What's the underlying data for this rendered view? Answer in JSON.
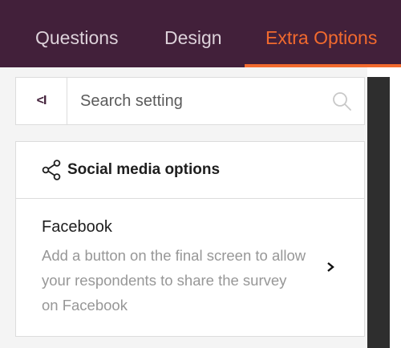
{
  "tabs": [
    {
      "label": "Questions",
      "active": false
    },
    {
      "label": "Design",
      "active": false
    },
    {
      "label": "Extra Options",
      "active": true
    }
  ],
  "search": {
    "collapse_label": "<I",
    "placeholder": "Search setting",
    "value": ""
  },
  "section": {
    "title": "Social media options",
    "icon": "share-icon",
    "items": [
      {
        "title": "Facebook",
        "description": "Add a button on the final screen to allow your respondents to share the survey on Facebook",
        "icon": "chevron-right-icon"
      }
    ]
  },
  "colors": {
    "tabbar_bg": "#42203a",
    "accent": "#f26a2e",
    "tab_text": "#ddd2da"
  }
}
